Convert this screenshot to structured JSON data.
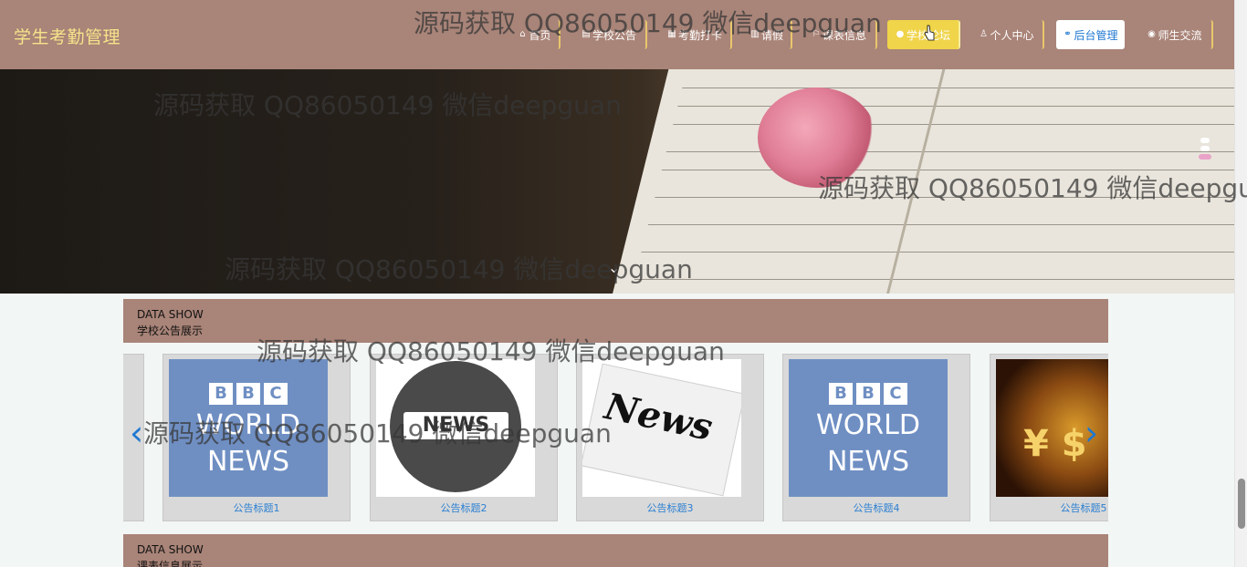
{
  "header": {
    "brand": "学生考勤管理",
    "nav": [
      {
        "icon": "home-icon",
        "glyph": "⌂",
        "label": "首页"
      },
      {
        "icon": "notice-icon",
        "glyph": "▤",
        "label": "学校公告"
      },
      {
        "icon": "checkin-icon",
        "glyph": "▦",
        "label": "考勤打卡"
      },
      {
        "icon": "leave-icon",
        "glyph": "▥",
        "label": "请假"
      },
      {
        "icon": "schedule-icon",
        "glyph": "⚐",
        "label": "课表信息"
      },
      {
        "icon": "forum-icon",
        "glyph": "●",
        "label": "学校论坛"
      },
      {
        "icon": "user-icon",
        "glyph": "♙",
        "label": "个人中心"
      },
      {
        "icon": "link-icon",
        "glyph": "⚭",
        "label": "后台管理"
      },
      {
        "icon": "chat-icon",
        "glyph": "◉",
        "label": "师生交流"
      }
    ]
  },
  "watermark": "源码获取 QQ86050149 微信deepguan",
  "banner": {
    "dots": 3,
    "active_dot": 3
  },
  "sections": {
    "notice": {
      "en": "DATA SHOW",
      "cn": "学校公告展示"
    },
    "schedule": {
      "en": "DATA SHOW",
      "cn": "课表信息展示"
    }
  },
  "carousel": {
    "items": [
      {
        "caption": "公告标题1",
        "image": "bbc-world-news"
      },
      {
        "caption": "公告标题2",
        "image": "news-globe"
      },
      {
        "caption": "公告标题3",
        "image": "news-paper"
      },
      {
        "caption": "公告标题4",
        "image": "bbc-world-news"
      },
      {
        "caption": "公告标题5",
        "image": "money-symbols"
      }
    ],
    "bbc": {
      "letters": [
        "B",
        "B",
        "C"
      ],
      "line1": "WORLD",
      "line2": "NEWS"
    },
    "globe_text": "NEWS",
    "paper_text": "News",
    "money_text": "¥ $",
    "prev": "‹",
    "next": "›"
  },
  "colors": {
    "header_bg": "#a98478",
    "brand": "#f5e38a",
    "active": "#f0d44a",
    "link": "#2b7fd2"
  }
}
